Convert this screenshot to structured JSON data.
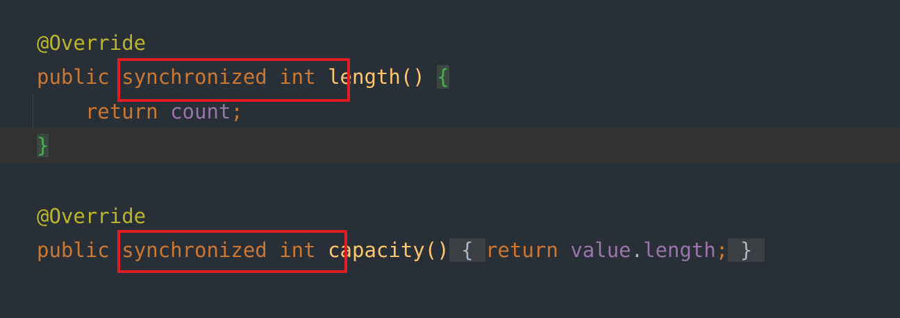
{
  "editor": {
    "block1": {
      "annotation": "@Override",
      "modifier_public": "public",
      "keyword_synchronized": "synchronized",
      "keyword_int": "int",
      "method_name": "length",
      "parens": "()",
      "open_brace": "{",
      "return_keyword": "return",
      "field_count": "count",
      "semicolon": ";",
      "close_brace": "}"
    },
    "block2": {
      "annotation": "@Override",
      "modifier_public": "public",
      "keyword_synchronized": "synchronized",
      "keyword_int": "int",
      "method_name": "capacity",
      "parens": "()",
      "open_brace": "{",
      "return_keyword": "return",
      "field_value": "value",
      "dot": ".",
      "field_length": "length",
      "semicolon": ";",
      "close_brace": "}"
    }
  },
  "colors": {
    "background": "#282f36",
    "annotation": "#bbb529",
    "keyword": "#cc7832",
    "method": "#ffc66d",
    "field": "#9876aa",
    "brace_match": "#4caf50",
    "highlight_box": "#e31b23"
  }
}
